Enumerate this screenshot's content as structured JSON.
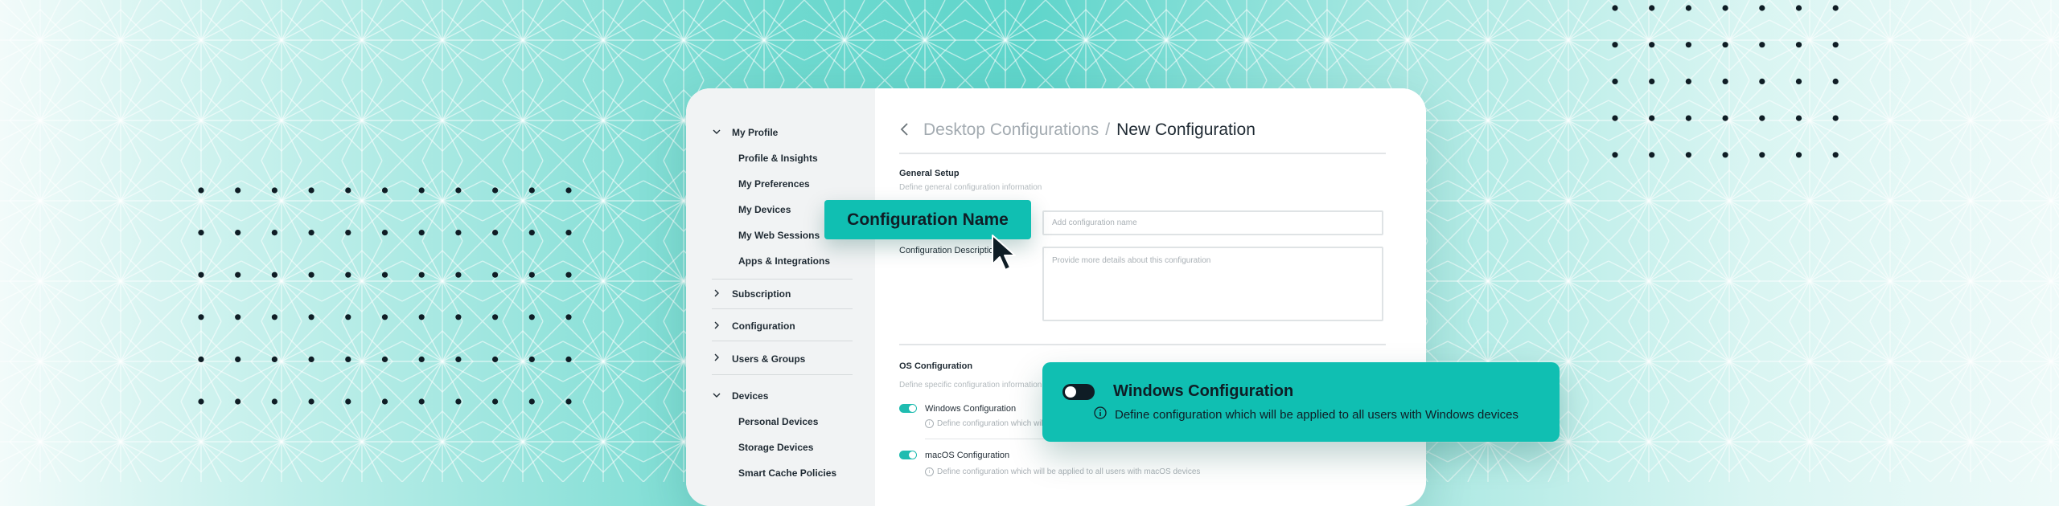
{
  "sidebar": {
    "items": [
      {
        "label": "My Profile",
        "expanded": true,
        "children": [
          "Profile & Insights",
          "My Preferences",
          "My Devices",
          "My Web Sessions",
          "Apps & Integrations"
        ]
      },
      {
        "label": "Subscription",
        "expanded": false
      },
      {
        "label": "Configuration",
        "expanded": false
      },
      {
        "label": "Users & Groups",
        "expanded": false
      },
      {
        "label": "Devices",
        "expanded": true,
        "children": [
          "Personal Devices",
          "Storage Devices",
          "Smart Cache Policies"
        ]
      }
    ]
  },
  "breadcrumb": {
    "parent": "Desktop Configurations",
    "separator": "/",
    "current": "New Configuration"
  },
  "general": {
    "title": "General Setup",
    "subtitle": "Define general configuration information",
    "name_label": "Configuration Name",
    "name_placeholder": "Add configuration name",
    "desc_label": "Configuration Description",
    "desc_placeholder": "Provide more details about this configuration"
  },
  "os": {
    "title": "OS Configuration",
    "subtitle": "Define specific configuration information",
    "options": [
      {
        "label": "Windows Configuration",
        "desc": "Define configuration which will be applied to all users with Windows devices",
        "enabled": true
      },
      {
        "label": "macOS Configuration",
        "desc": "Define configuration which will be applied to all users with macOS devices",
        "enabled": true
      }
    ]
  },
  "callout_name": {
    "label": "Configuration Name"
  },
  "callout_windows": {
    "title": "Windows Configuration",
    "desc": "Define configuration which will be applied to all users with Windows devices",
    "enabled": false
  },
  "colors": {
    "accent": "#10bfb2",
    "text": "#1f2a33",
    "muted": "#a3abb1",
    "sidebar_bg": "#f1f3f4"
  },
  "icons": [
    "chevron-down-icon",
    "chevron-right-icon",
    "back-arrow-icon",
    "info-icon",
    "cursor-icon"
  ]
}
